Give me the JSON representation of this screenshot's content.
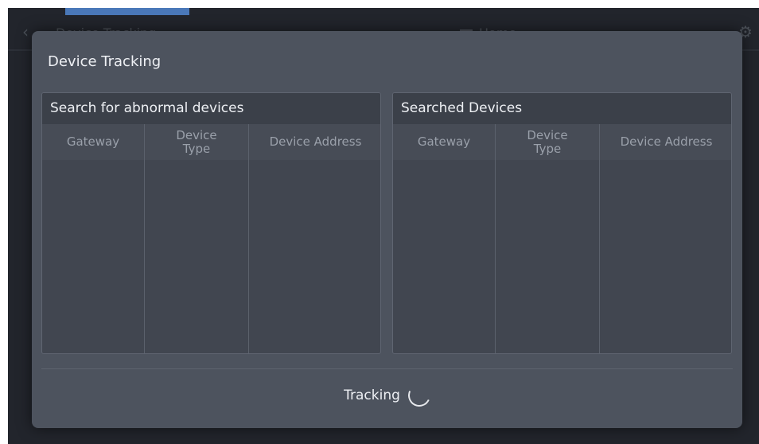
{
  "background": {
    "back_icon": "‹",
    "title": "Device Tracking",
    "home_label": "Home",
    "date": "",
    "gear_icon": "gear-icon"
  },
  "dialog": {
    "title": "Device Tracking",
    "left_panel": {
      "title": "Search for abnormal devices",
      "columns": [
        "Gateway",
        "Device\nType",
        "Device Address"
      ]
    },
    "right_panel": {
      "title": "Searched Devices",
      "columns": [
        "Gateway",
        "Device\nType",
        "Device Address"
      ]
    },
    "status_label": "Tracking"
  },
  "colors": {
    "accent_tab": "#4a78b8",
    "dialog_bg": "#4d535e",
    "panel_bg": "#414650",
    "text_primary": "#eef0f4",
    "text_secondary": "#9aa0aa"
  }
}
